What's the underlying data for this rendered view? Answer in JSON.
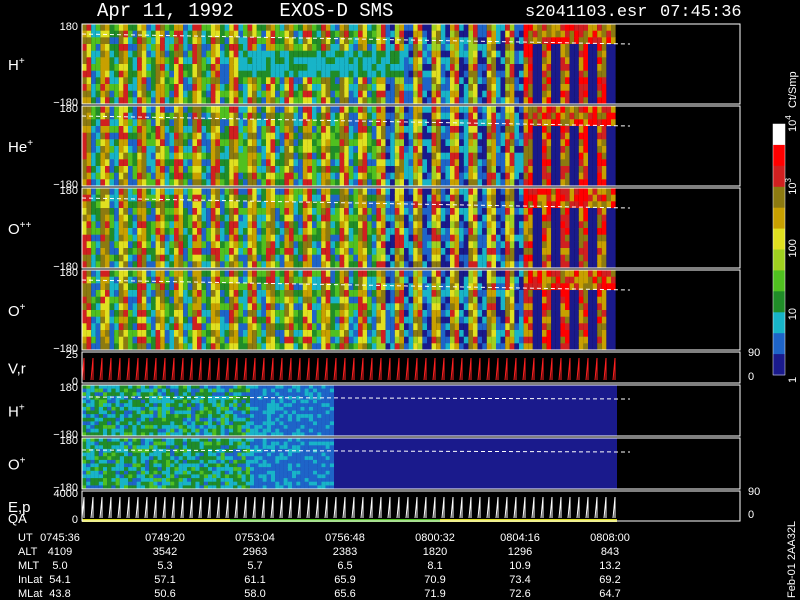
{
  "header": {
    "title": "Apr 11, 1992    EXOS-D SMS",
    "file": "s2041103.esr",
    "time": "07:45:36"
  },
  "colors": {
    "background": "#000000",
    "frame": "#ffffff",
    "scale": [
      "#1a1a8c",
      "#1e64c8",
      "#18b4c8",
      "#208c28",
      "#50c020",
      "#a0d020",
      "#e0e020",
      "#c8a000",
      "#8c7a10",
      "#d02020",
      "#ff0000",
      "#ffffff"
    ]
  },
  "colorbar": {
    "unit": "Ct/Smp",
    "ticks": [
      {
        "label": "1",
        "value": 1
      },
      {
        "label": "10",
        "value": 10
      },
      {
        "label": "100",
        "value": 100
      },
      {
        "label": "10",
        "sup": "3",
        "value": 1000
      },
      {
        "label": "10",
        "sup": "4",
        "value": 10000
      }
    ]
  },
  "chart_data": [
    {
      "type": "heatmap",
      "label": "H",
      "sup": "+",
      "ylim": [
        -180,
        180
      ],
      "yticks": [
        "180",
        "−180"
      ]
    },
    {
      "type": "heatmap",
      "label": "He",
      "sup": "+",
      "ylim": [
        -180,
        180
      ],
      "yticks": [
        "180",
        "−180"
      ]
    },
    {
      "type": "heatmap",
      "label": "O",
      "sup": "++",
      "ylim": [
        -180,
        180
      ],
      "yticks": [
        "180",
        "−180"
      ]
    },
    {
      "type": "heatmap",
      "label": "O",
      "sup": "+",
      "ylim": [
        -180,
        180
      ],
      "yticks": [
        "180",
        "−180"
      ]
    },
    {
      "type": "line",
      "label": "V,r",
      "ylim": [
        0,
        25
      ],
      "yticks": [
        "25",
        "0"
      ],
      "right_ticks": [
        "90",
        "0"
      ]
    },
    {
      "type": "heatmap",
      "label": "H",
      "sup": "+",
      "ylim": [
        -180,
        180
      ],
      "yticks": [
        "180",
        "−180"
      ]
    },
    {
      "type": "heatmap",
      "label": "O",
      "sup": "+",
      "ylim": [
        -180,
        180
      ],
      "yticks": [
        "180",
        "−180"
      ]
    },
    {
      "type": "line",
      "label": "E,p",
      "label2": "QA",
      "ylim": [
        0,
        4000
      ],
      "yticks": [
        "4000",
        "0"
      ],
      "right_ticks": [
        "90",
        "0"
      ]
    }
  ],
  "orbit_table": {
    "rows": [
      {
        "name": "UT",
        "values": [
          "0745:36",
          "0749:20",
          "0753:04",
          "0756:48",
          "0800:32",
          "0804:16",
          "0808:00"
        ]
      },
      {
        "name": "ALT",
        "values": [
          "4109",
          "3542",
          "2963",
          "2383",
          "1820",
          "1296",
          "843"
        ]
      },
      {
        "name": "MLT",
        "values": [
          "5.0",
          "5.3",
          "5.7",
          "6.5",
          "8.1",
          "10.9",
          "13.2"
        ]
      },
      {
        "name": "InLat",
        "values": [
          "54.1",
          "57.1",
          "61.1",
          "65.9",
          "70.9",
          "73.4",
          "69.2"
        ]
      },
      {
        "name": "MLat",
        "values": [
          "43.8",
          "50.6",
          "58.0",
          "65.6",
          "71.9",
          "72.6",
          "64.7"
        ]
      }
    ]
  },
  "footer": {
    "stamp": "Feb-01 2AA32L"
  }
}
